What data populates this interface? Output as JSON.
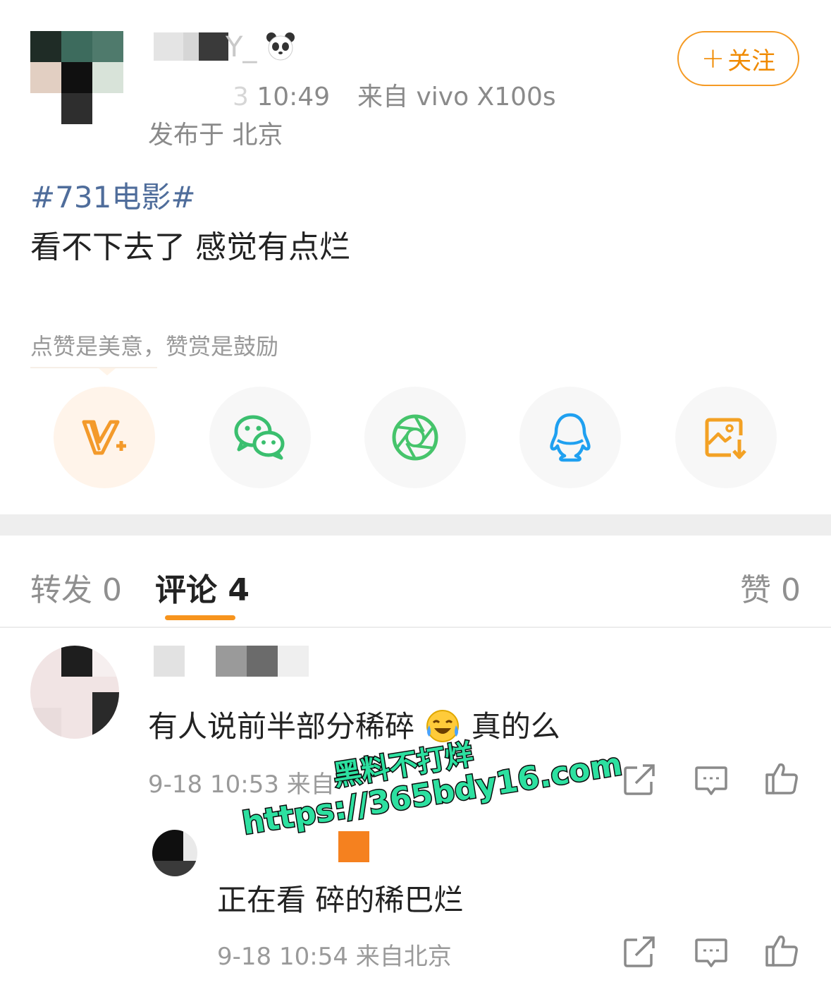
{
  "post": {
    "author": {
      "name_suffix": "Y_",
      "badge_icon": "panda-icon",
      "avatar": "pixelated-avatar"
    },
    "time": "10:49",
    "time_prefix_blur": "3",
    "source": "来自 vivo X100s",
    "location": "发布于 北京",
    "follow_label": "关注",
    "follow_plus": "+",
    "hashtag": "#731电影#",
    "text": "看不下去了 感觉有点烂",
    "reward_tip": "点赞是美意，赞赏是鼓励"
  },
  "share": {
    "items": [
      {
        "name": "vplus-icon",
        "color": "#f39a2b"
      },
      {
        "name": "wechat-icon",
        "color": "#3bbf6f"
      },
      {
        "name": "moments-icon",
        "color": "#46c46b"
      },
      {
        "name": "qq-icon",
        "color": "#1fa0f0"
      },
      {
        "name": "save-image-icon",
        "color": "#f3a124"
      }
    ]
  },
  "tabs": {
    "repost": "转发 0",
    "comments": "评论 4",
    "likes": "赞 0"
  },
  "comments": [
    {
      "text_before_emoji": "有人说前半部分稀碎",
      "emoji": "laughing-crying-emoji",
      "text_after_emoji": " 真的么",
      "meta": "9-18 10:53  来自"
    }
  ],
  "reply": {
    "text": "正在看 碎的稀巴烂",
    "meta": "9-18 10:54  来自北京"
  },
  "watermark": {
    "line1": "黑料不打烊",
    "line2": "https://365bdy16.com"
  },
  "colors": {
    "accent": "#f7941d",
    "hashtag": "#4f6d9b",
    "meta_gray": "#9a9a9a"
  }
}
